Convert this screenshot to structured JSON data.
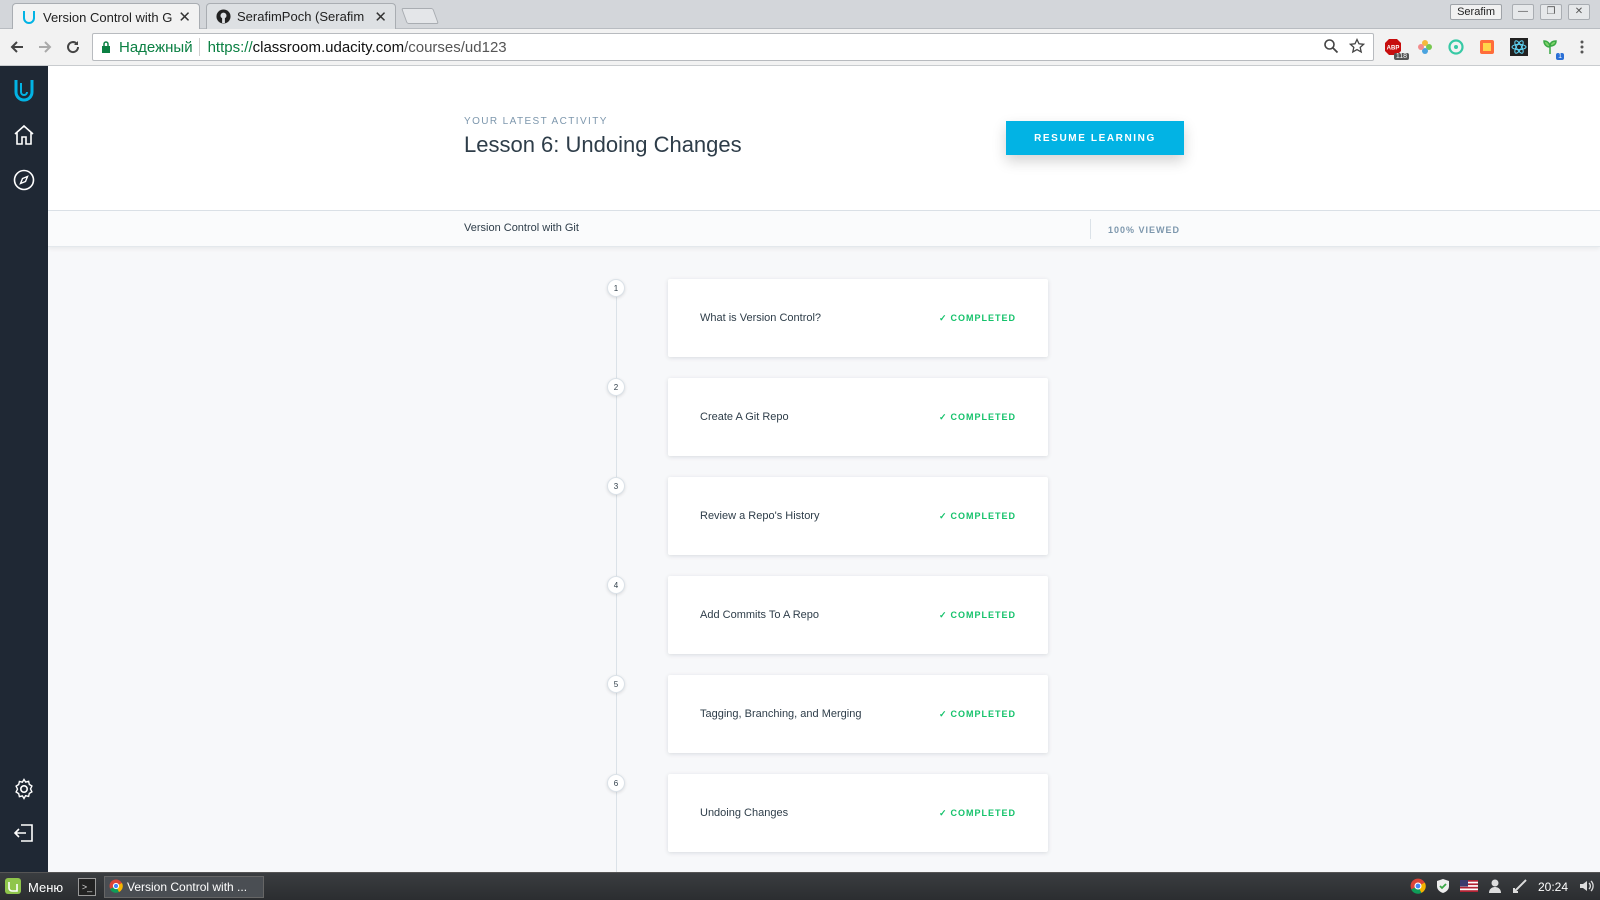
{
  "browser": {
    "tabs": [
      {
        "label": "Version Control with Git",
        "active": true,
        "icon": "udacity-icon"
      },
      {
        "label": "SerafimPoch (Serafim P",
        "active": false,
        "icon": "github-icon"
      }
    ],
    "user_chip": "Serafim",
    "secure_label": "Надежный",
    "url_scheme": "https://",
    "url_host": "classroom.udacity.com",
    "url_path": "/courses/ud123",
    "extensions": [
      "adblock-icon",
      "flower-icon",
      "circle-icon",
      "photo-icon",
      "react-icon",
      "plant-icon"
    ],
    "adblock_count": "118",
    "badge_count": "1"
  },
  "sidebar": {
    "items": [
      "udacity-logo-icon",
      "home-icon",
      "compass-icon",
      "settings-icon",
      "logout-icon"
    ]
  },
  "header": {
    "eyebrow": "YOUR LATEST ACTIVITY",
    "lesson_title": "Lesson 6: Undoing Changes",
    "resume_label": "RESUME LEARNING"
  },
  "course_bar": {
    "course_name": "Version Control with Git",
    "viewed": "100% VIEWED"
  },
  "lessons": [
    {
      "number": "1",
      "title": "What is Version Control?",
      "status": "COMPLETED"
    },
    {
      "number": "2",
      "title": "Create A Git Repo",
      "status": "COMPLETED"
    },
    {
      "number": "3",
      "title": "Review a Repo's History",
      "status": "COMPLETED"
    },
    {
      "number": "4",
      "title": "Add Commits To A Repo",
      "status": "COMPLETED"
    },
    {
      "number": "5",
      "title": "Tagging, Branching, and Merging",
      "status": "COMPLETED"
    },
    {
      "number": "6",
      "title": "Undoing Changes",
      "status": "COMPLETED"
    }
  ],
  "taskbar": {
    "menu_label": "Меню",
    "window_label": "Version Control with ...",
    "clock": "20:24"
  },
  "colors": {
    "accent": "#02b3e4",
    "completed": "#15c26b",
    "sidebar": "#1f2834",
    "text": "#2e3d49"
  }
}
